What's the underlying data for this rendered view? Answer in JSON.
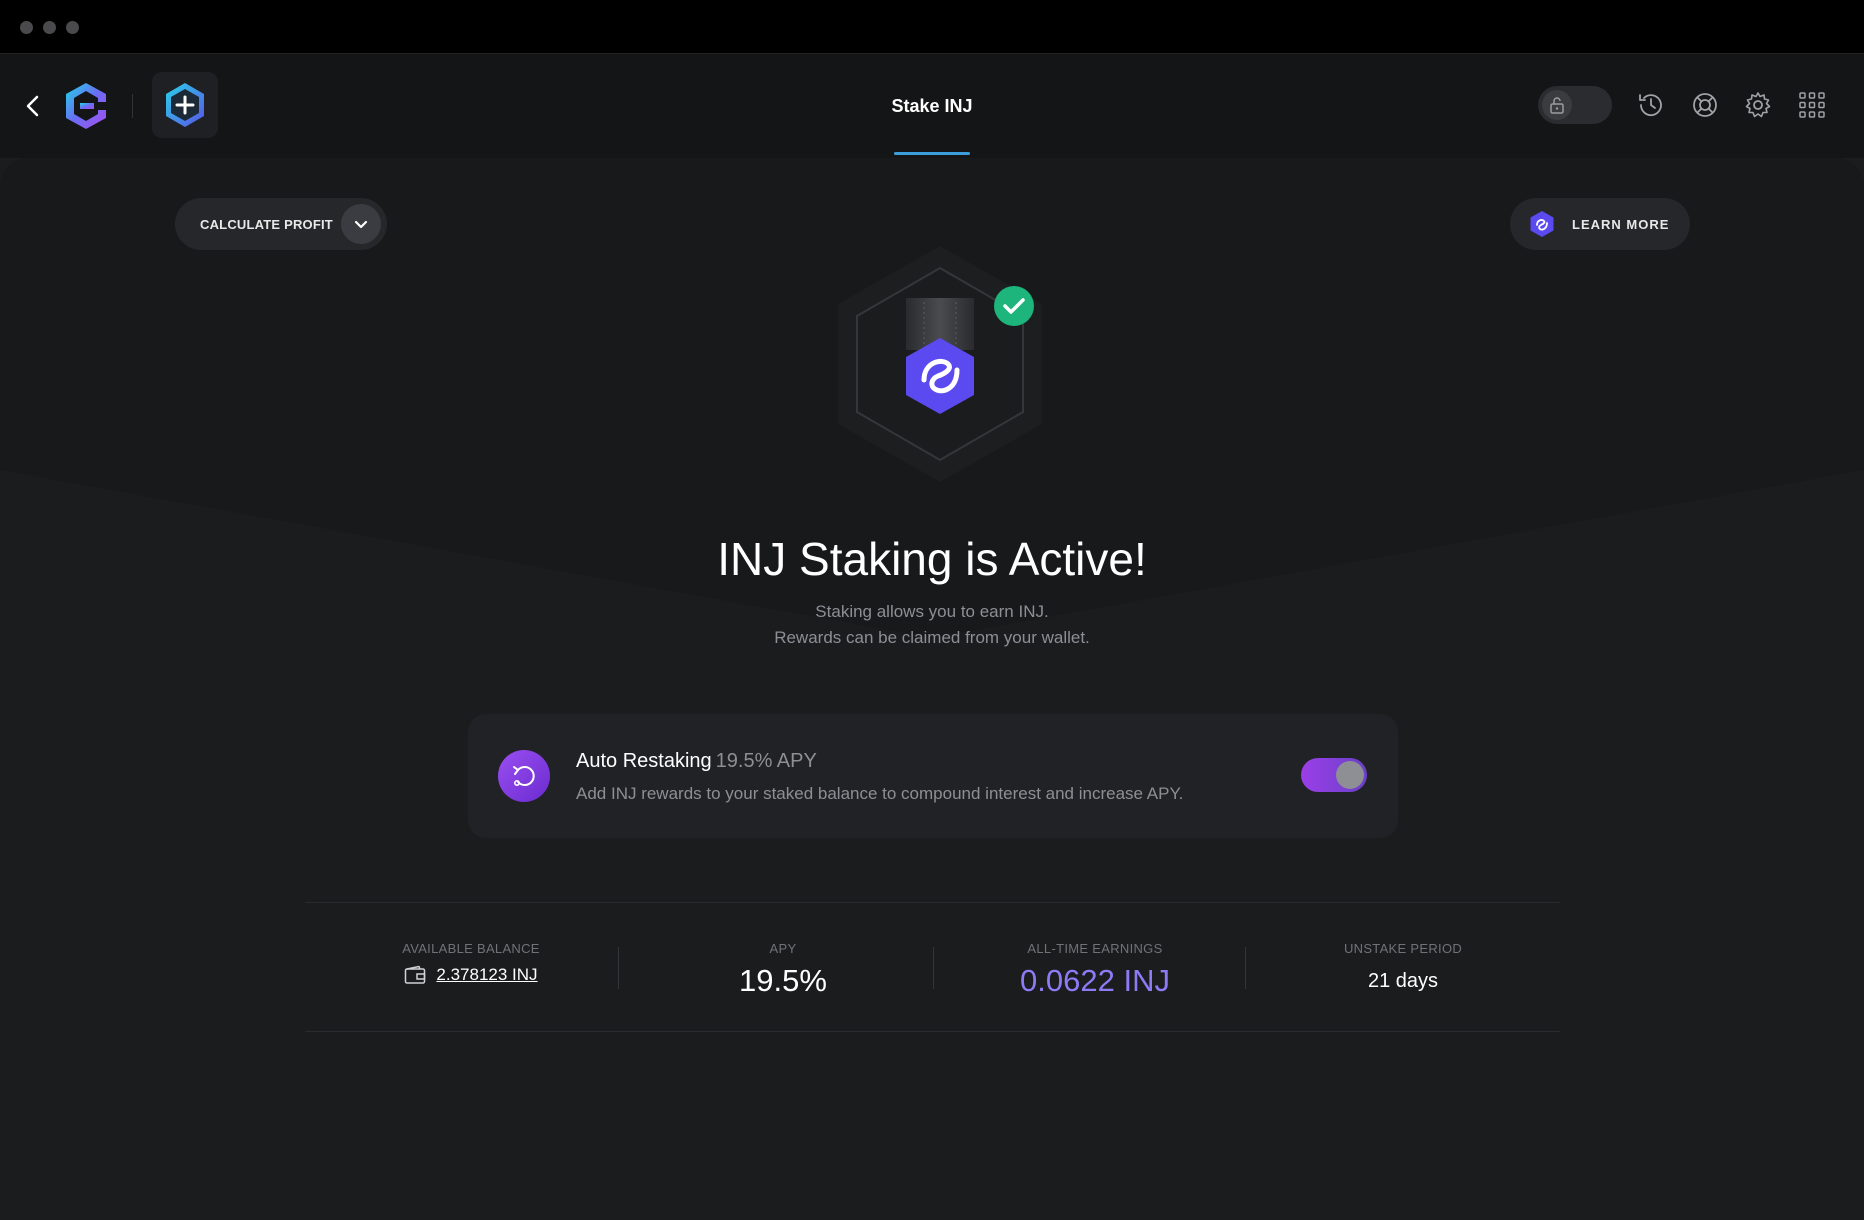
{
  "header": {
    "title": "Stake INJ"
  },
  "controls": {
    "calculate_profit_label": "CALCULATE PROFIT",
    "learn_more_label": "LEARN MORE"
  },
  "hero": {
    "headline": "INJ Staking is Active!",
    "subtitle_line1": "Staking allows you to earn INJ.",
    "subtitle_line2": "Rewards can be claimed from your wallet."
  },
  "auto_restaking": {
    "title": "Auto Restaking",
    "apy": "19.5% APY",
    "description": "Add INJ rewards to your staked balance to compound interest and increase APY.",
    "enabled": true
  },
  "stats": {
    "available_balance_label": "AVAILABLE BALANCE",
    "available_balance_value": "2.378123 INJ",
    "apy_label": "APY",
    "apy_value": "19.5%",
    "earnings_label": "ALL-TIME EARNINGS",
    "earnings_value": "0.0622 INJ",
    "unstake_label": "UNSTAKE PERIOD",
    "unstake_value": "21 days"
  },
  "colors": {
    "accent_blue": "#3b9edb",
    "earnings_purple": "#8b7cf6",
    "toggle_gradient_start": "#9b3fe8",
    "success_green": "#1db57c",
    "inj_hex": "#5b4af0"
  },
  "icons": {
    "back": "chevron-left-icon",
    "logo": "exodus-logo",
    "app": "plus-hex-icon",
    "lock": "lock-icon",
    "history": "history-icon",
    "support": "lifebuoy-icon",
    "settings": "gear-icon",
    "apps": "grid-icon",
    "check": "check-icon",
    "restake": "restake-icon",
    "wallet": "wallet-icon"
  }
}
